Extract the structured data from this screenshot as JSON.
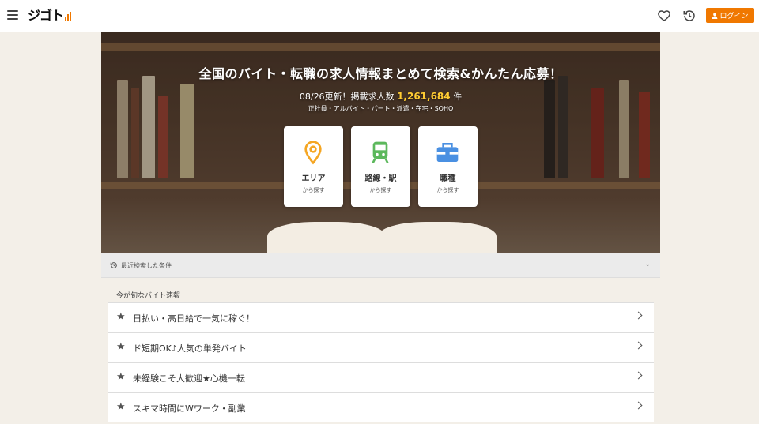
{
  "header": {
    "logo_text": "ジゴト",
    "login_label": "ログイン",
    "menu_icon": "hamburger-icon",
    "favorite_icon": "heart-icon",
    "history_icon": "history-icon",
    "user_icon": "user-icon"
  },
  "hero": {
    "title": "全国のバイト・転職の求人情報まとめて検索&かんたん応募！",
    "update_prefix": "08/26更新！掲載求人数",
    "job_count": "1,261,684",
    "count_suffix": "件",
    "subtitle": "正社員・アルバイト・パート・派遣・在宅・SOHO",
    "cards": [
      {
        "title": "エリア",
        "sub": "から探す",
        "icon": "map-pin-icon",
        "color": "#f5a623"
      },
      {
        "title": "路線・駅",
        "sub": "から探す",
        "icon": "train-icon",
        "color": "#5cb85c"
      },
      {
        "title": "職種",
        "sub": "から探す",
        "icon": "briefcase-icon",
        "color": "#4a90e2"
      }
    ]
  },
  "recent": {
    "label": "最近検索した条件",
    "chevron": "⌄"
  },
  "list": {
    "heading": "今が旬なバイト速報",
    "items": [
      {
        "label": "日払い・高日給で一気に稼ぐ！"
      },
      {
        "label": "ド短期OK♪人気の単発バイト"
      },
      {
        "label": "未経験こそ大歓迎★心機一転"
      },
      {
        "label": "スキマ時間にWワーク・副業"
      }
    ]
  },
  "colors": {
    "accent": "#f07800",
    "count_highlight": "#ffcc33",
    "background": "#f3efe8"
  }
}
